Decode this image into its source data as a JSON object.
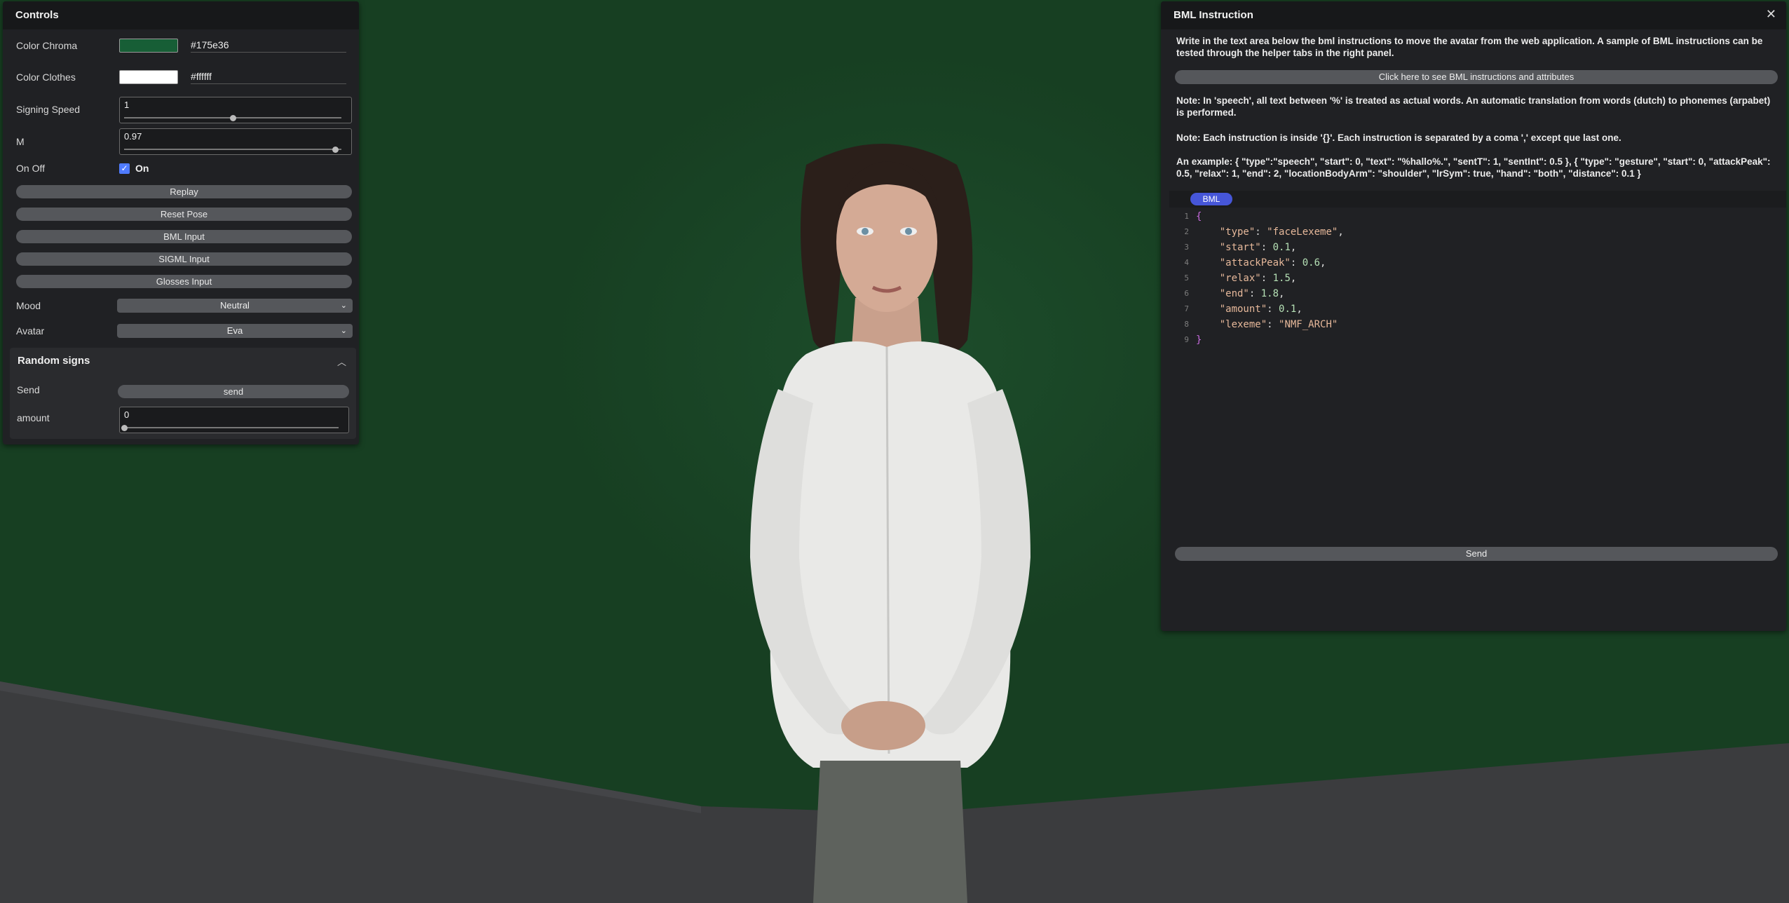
{
  "controls": {
    "title": "Controls",
    "color_chroma": {
      "label": "Color Chroma",
      "value": "#175e36",
      "swatch": "#175e36"
    },
    "color_clothes": {
      "label": "Color Clothes",
      "value": "#ffffff",
      "swatch": "#ffffff"
    },
    "signing_speed": {
      "label": "Signing Speed",
      "value": "1",
      "fraction": 0.5
    },
    "m": {
      "label": "M",
      "value": "0.97",
      "fraction": 0.97
    },
    "on_off": {
      "label": "On Off",
      "checkbox_label": "On",
      "checked": true
    },
    "buttons": {
      "replay": "Replay",
      "reset_pose": "Reset Pose",
      "bml_input": "BML Input",
      "sigml_input": "SIGML Input",
      "glosses_input": "Glosses Input"
    },
    "mood": {
      "label": "Mood",
      "value": "Neutral"
    },
    "avatar": {
      "label": "Avatar",
      "value": "Eva"
    },
    "random_signs": {
      "title": "Random signs",
      "send_label": "Send",
      "send_button": "send",
      "amount_label": "amount",
      "amount_value": "0",
      "amount_fraction": 0
    }
  },
  "bml": {
    "title": "BML Instruction",
    "close_glyph": "✕",
    "intro": "Write in the text area below the bml instructions to move the avatar from the web application. A sample of BML instructions can be tested through the helper tabs in the right panel.",
    "help_button": "Click here to see BML instructions and attributes",
    "note_speech": "Note: In 'speech', all text between '%' is treated as actual words. An automatic translation from words (dutch) to phonemes (arpabet) is performed.",
    "note_instruction": "Note: Each instruction is inside '{}'. Each instruction is separated by a coma ',' except que last one.",
    "example": "An example: { \"type\":\"speech\", \"start\": 0, \"text\": \"%hallo%.\", \"sentT\": 1, \"sentInt\": 0.5 }, { \"type\": \"gesture\", \"start\": 0, \"attackPeak\": 0.5, \"relax\": 1, \"end\": 2, \"locationBodyArm\": \"shoulder\", \"lrSym\": true, \"hand\": \"both\", \"distance\": 0.1 }",
    "tab_label": "BML",
    "send_button": "Send",
    "code": {
      "line_numbers": [
        "1",
        "2",
        "3",
        "4",
        "5",
        "6",
        "7",
        "8",
        "9"
      ],
      "open_brace": "{",
      "close_brace": "}",
      "entries": [
        {
          "key": "\"type\"",
          "value": "\"faceLexeme\"",
          "kind": "string"
        },
        {
          "key": "\"start\"",
          "value": "0.1",
          "kind": "number"
        },
        {
          "key": "\"attackPeak\"",
          "value": "0.6",
          "kind": "number"
        },
        {
          "key": "\"relax\"",
          "value": "1.5",
          "kind": "number"
        },
        {
          "key": "\"end\"",
          "value": "1.8",
          "kind": "number"
        },
        {
          "key": "\"amount\"",
          "value": "0.1",
          "kind": "number"
        },
        {
          "key": "\"lexeme\"",
          "value": "\"NMF_ARCH\"",
          "kind": "string"
        }
      ]
    }
  },
  "colors": {
    "background": "#173f22",
    "floor": "#3b3c3e",
    "panel": "#202124",
    "accent": "#4656d8",
    "checkbox": "#4f7bff"
  },
  "icons": {
    "close": "close-icon",
    "chevron": "chevron-down-icon",
    "collapse": "chevron-up-icon",
    "check": "checkmark-icon"
  }
}
